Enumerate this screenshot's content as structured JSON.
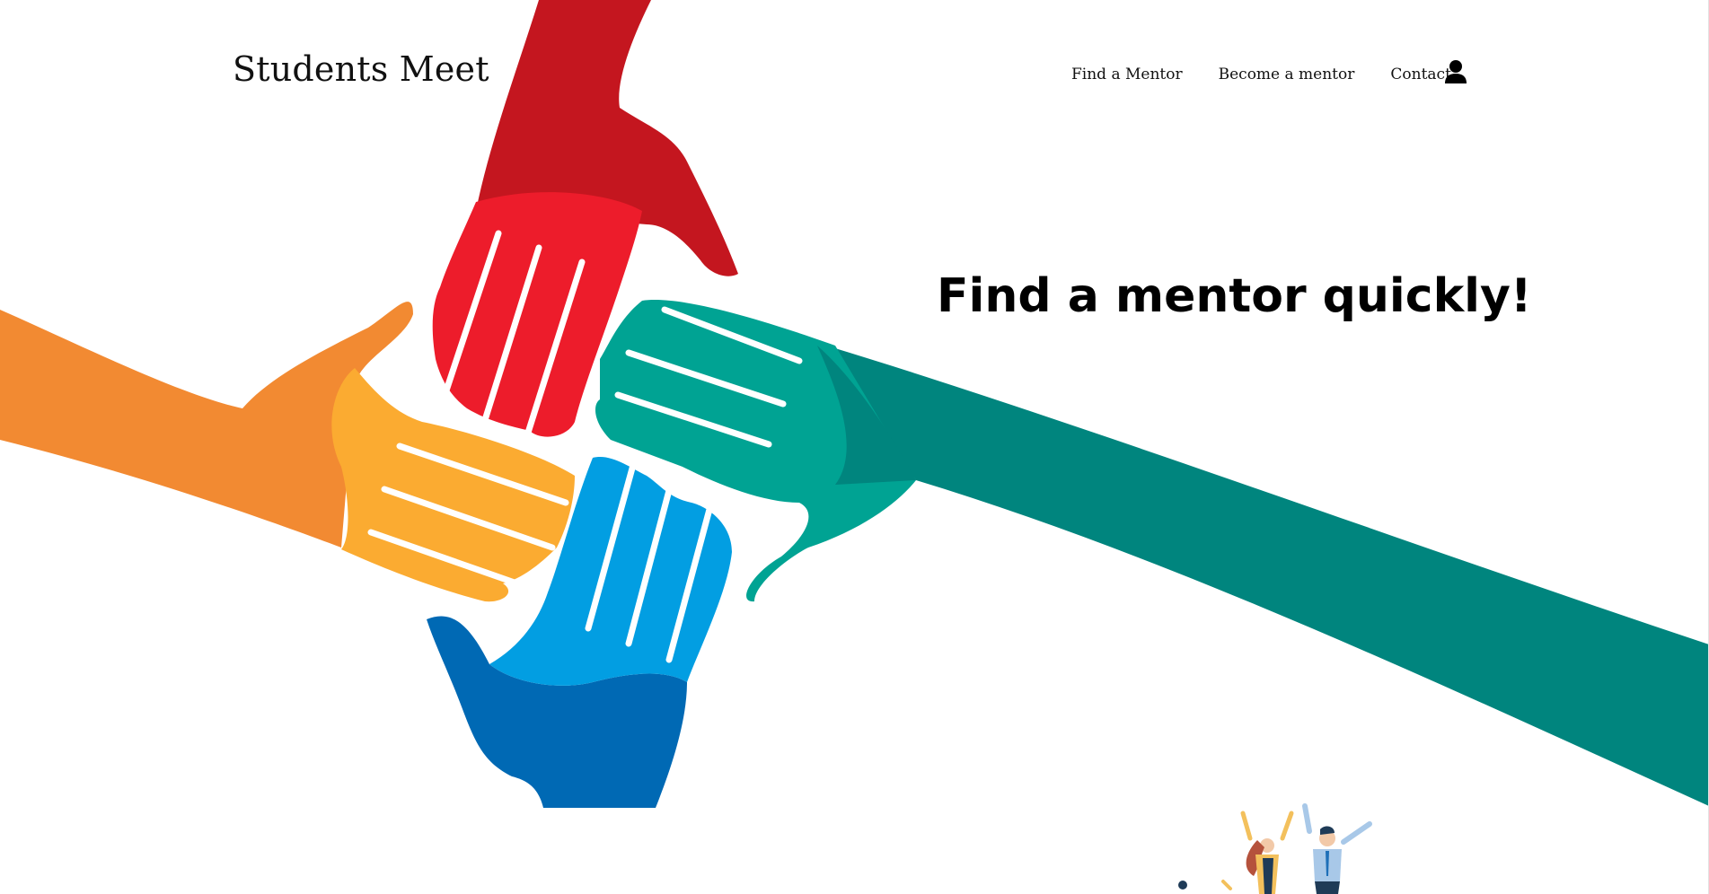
{
  "header": {
    "brand": "Students Meet",
    "nav": [
      {
        "label": "Find a Mentor"
      },
      {
        "label": "Become a mentor"
      },
      {
        "label": "Contact"
      }
    ],
    "user_icon": "person-icon"
  },
  "hero": {
    "headline": "Find a mentor quickly!",
    "illustration": "four-hands-illustration",
    "colors": {
      "red": "#ed1c2b",
      "red_dark": "#c4161f",
      "orange": "#f28a32",
      "yellow": "#fbab31",
      "blue": "#029ee2",
      "blue_dark": "#0069b4",
      "teal": "#009c8c",
      "teal_dark": "#00857e"
    }
  },
  "secondary": {
    "illustration": "celebrating-people-illustration"
  }
}
